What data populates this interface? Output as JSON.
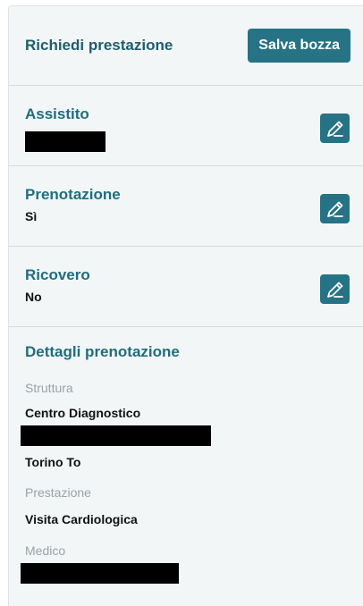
{
  "header": {
    "title": "Richiedi prestazione",
    "save_label": "Salva bozza"
  },
  "sections": [
    {
      "title": "Assistito",
      "value": ""
    },
    {
      "title": "Prenotazione",
      "value": "Sì"
    },
    {
      "title": "Ricovero",
      "value": "No"
    }
  ],
  "details": {
    "title": "Dettagli prenotazione",
    "struttura_label": "Struttura",
    "struttura_name": "Centro Diagnostico",
    "struttura_city": "Torino To",
    "prestazione_label": "Prestazione",
    "prestazione_value": "Visita Cardiologica",
    "medico_label": "Medico"
  },
  "colors": {
    "accent": "#257384",
    "title": "#1f6e7e",
    "panel_bg": "#f3f6f7"
  },
  "icons": {
    "edit": "pencil-icon"
  }
}
